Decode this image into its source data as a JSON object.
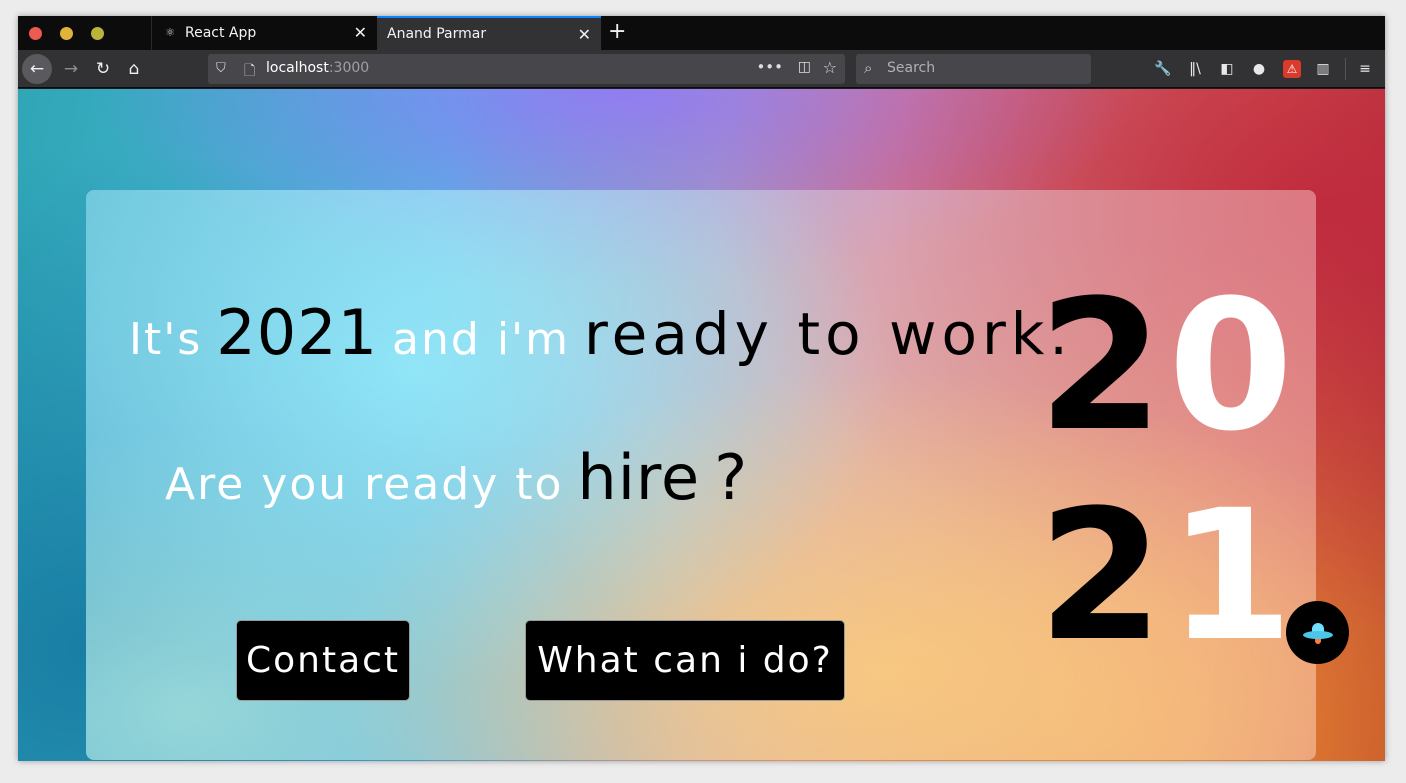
{
  "browser": {
    "tabs": [
      {
        "label": "React App",
        "favicon": "react-icon"
      },
      {
        "label": "Anand Parmar",
        "active": true
      }
    ],
    "new_tab_label": "+",
    "close_glyph": "✕",
    "url_host": "localhost",
    "url_port": ":3000",
    "search_placeholder": "Search",
    "icons": [
      "back-icon",
      "forward-icon",
      "reload-icon",
      "home-icon",
      "shield-icon",
      "page-icon",
      "more-icon",
      "pocket-icon",
      "star-icon",
      "search-icon",
      "wrench-icon",
      "library-icon",
      "sidebar-icon",
      "account-icon",
      "extension-icon",
      "grid-icon",
      "menu-icon"
    ]
  },
  "hero": {
    "line1": {
      "its": "It's",
      "year": "2021",
      "and_im": "and i'm",
      "rest": "ready to work."
    },
    "line2": {
      "prefix": "Are you ready to",
      "hire": "hire",
      "q": "?"
    },
    "year_digits": [
      "2",
      "0",
      "2",
      "1"
    ]
  },
  "buttons": {
    "contact": "Contact",
    "what": "What can i do?"
  },
  "fab_icon": "ufo-icon",
  "colors": {
    "accent_tab": "#0a84ff",
    "button_bg": "#000000",
    "text_light": "#ffffff",
    "text_dark": "#000000"
  }
}
